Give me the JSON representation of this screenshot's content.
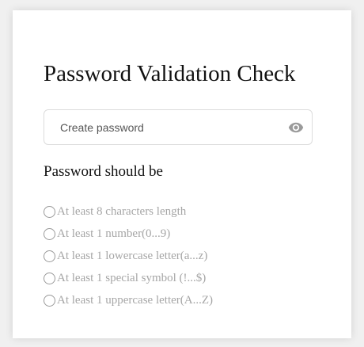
{
  "form": {
    "title": "Password Validation Check",
    "password_input": {
      "placeholder": "Create password",
      "value": ""
    },
    "toggle_icon": "eye-icon",
    "requirements_heading": "Password should be",
    "requirements": [
      {
        "label": "At least 8 characters length",
        "met": false
      },
      {
        "label": "At least 1 number(0...9)",
        "met": false
      },
      {
        "label": "At least 1 lowercase letter(a...z)",
        "met": false
      },
      {
        "label": "At least 1 special symbol (!...$)",
        "met": false
      },
      {
        "label": "At least 1 uppercase letter(A...Z)",
        "met": false
      }
    ]
  },
  "colors": {
    "background": "#f0f0f0",
    "card": "#ffffff",
    "requirement_unmet": "#a6a6a6",
    "input_border": "#dcdcdc",
    "icon": "#9a9a9a"
  }
}
